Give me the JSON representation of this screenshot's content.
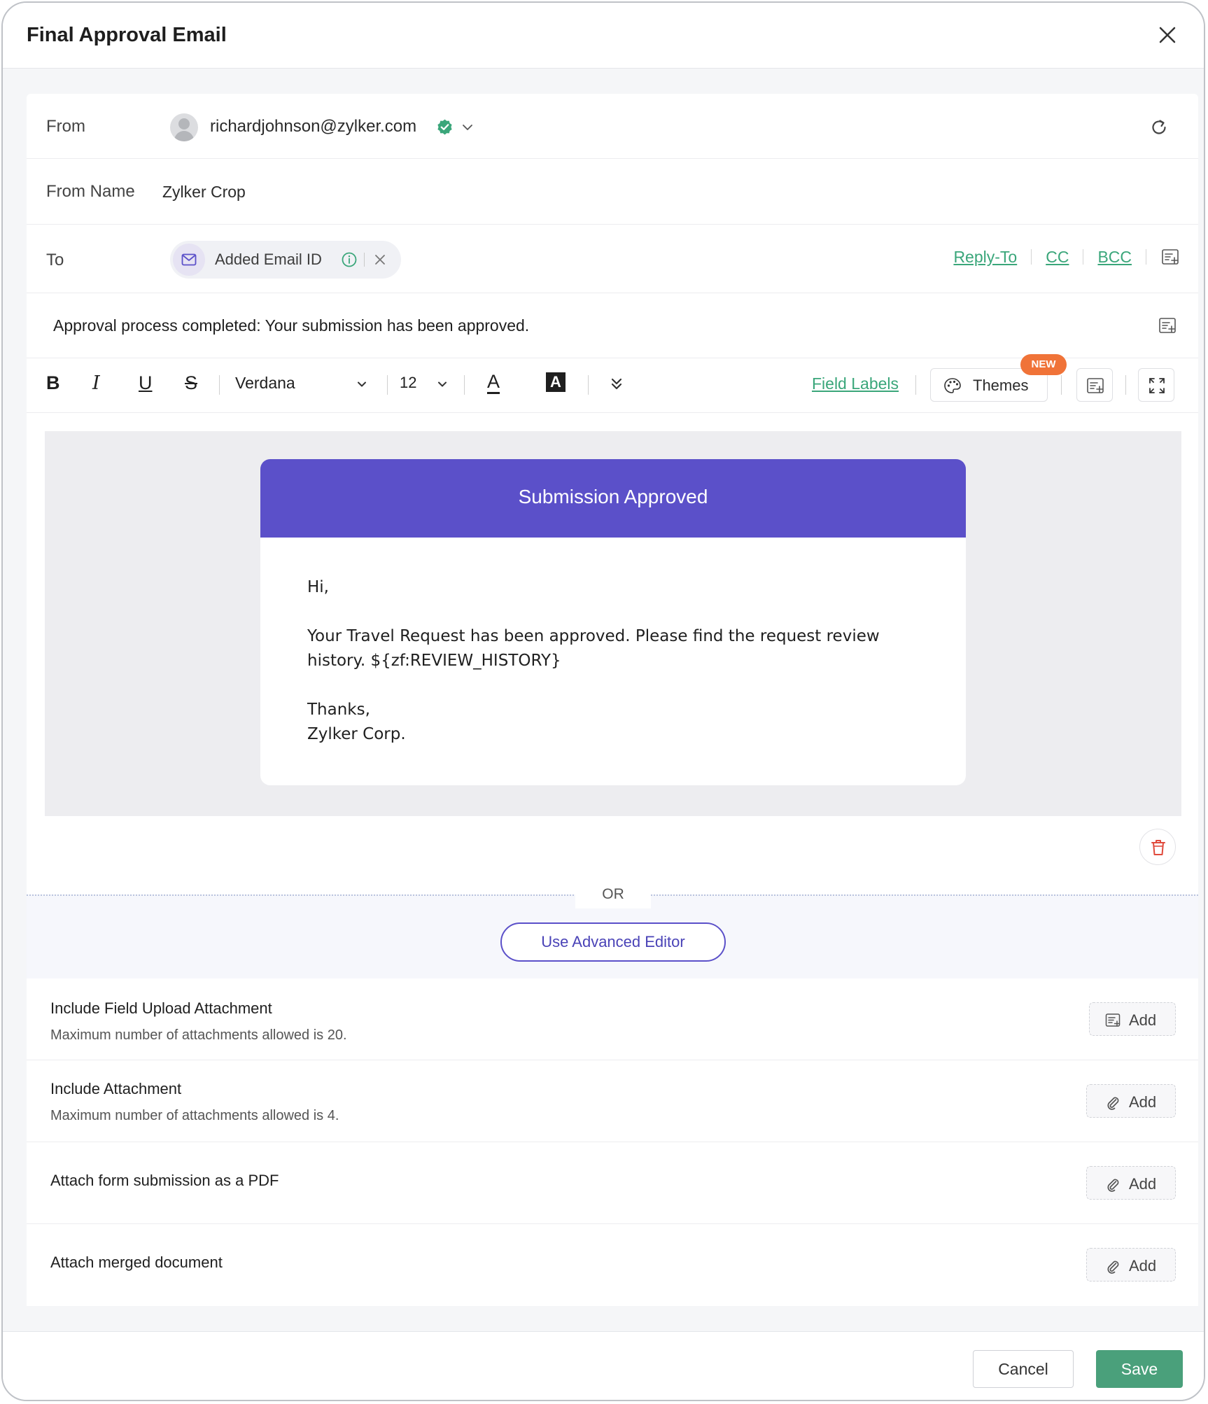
{
  "modal": {
    "title": "Final Approval Email"
  },
  "from": {
    "label": "From",
    "email": "richardjohnson@zylker.com"
  },
  "from_name": {
    "label": "From Name",
    "value": "Zylker Crop"
  },
  "to": {
    "label": "To",
    "chip_label": "Added Email ID",
    "links": [
      "Reply-To",
      "CC",
      "BCC"
    ]
  },
  "subject": {
    "text": "Approval process completed: Your submission has been approved."
  },
  "toolbar": {
    "bold": "B",
    "italic": "I",
    "underline": "U",
    "strike": "S",
    "font": "Verdana",
    "size": "12",
    "text_color": "A",
    "bg_color": "A",
    "field_labels": "Field Labels",
    "themes": "Themes",
    "new_badge": "NEW"
  },
  "email": {
    "header_title": "Submission Approved",
    "greeting": "Hi,",
    "body": "Your Travel Request has been approved. Please find the request review history. ${zf:REVIEW_HISTORY}",
    "signoff_1": "Thanks,",
    "signoff_2": "Zylker Corp.",
    "header_color": "#5b50c9"
  },
  "or_section": {
    "or_label": "OR",
    "advanced_editor": "Use Advanced Editor"
  },
  "attachments": [
    {
      "title": "Include Field Upload Attachment",
      "subtitle": "Maximum number of attachments allowed is 20.",
      "button": "Add"
    },
    {
      "title": "Include Attachment",
      "subtitle": "Maximum number of attachments allowed is 4.",
      "button": "Add"
    },
    {
      "title": "Attach form submission as a PDF",
      "subtitle": "",
      "button": "Add"
    },
    {
      "title": "Attach merged document",
      "subtitle": "",
      "button": "Add"
    }
  ],
  "footer": {
    "cancel": "Cancel",
    "save": "Save"
  },
  "colors": {
    "accent_green": "#4aa07b",
    "link_green": "#3aa67a",
    "brand_purple": "#5b50c9",
    "badge_orange": "#f07338"
  }
}
